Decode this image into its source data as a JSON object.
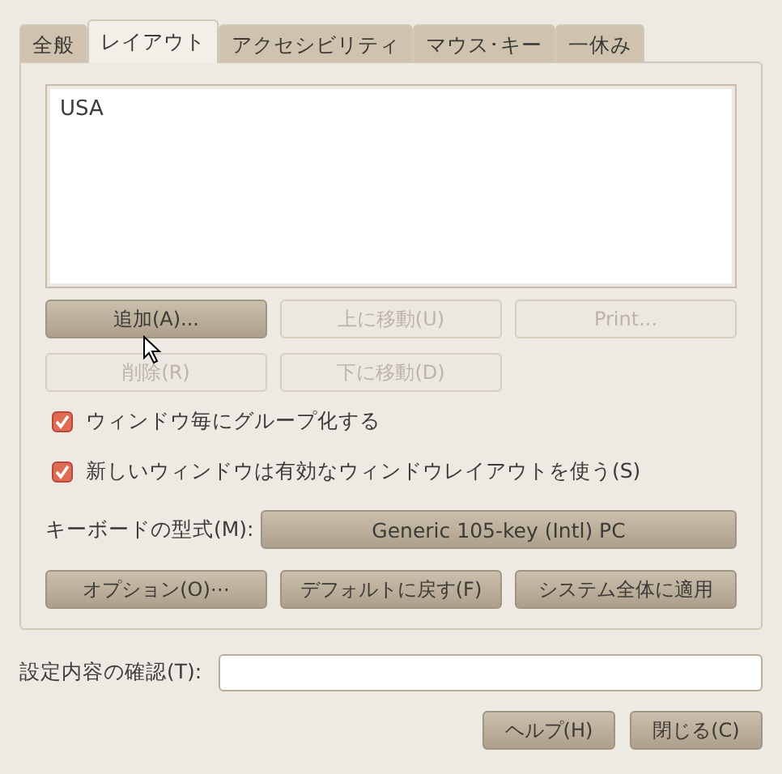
{
  "tabs": [
    {
      "label": "全般",
      "selected": false
    },
    {
      "label": "レイアウト",
      "selected": true
    },
    {
      "label": "アクセシビリティ",
      "selected": false
    },
    {
      "label": "マウス･キー",
      "selected": false
    },
    {
      "label": "一休み",
      "selected": false
    }
  ],
  "layout_list": {
    "items": [
      "USA"
    ]
  },
  "list_buttons": [
    {
      "label": "追加(A)...",
      "disabled": false
    },
    {
      "label": "上に移動(U)",
      "disabled": true
    },
    {
      "label": "Print...",
      "disabled": true
    },
    {
      "label": "削除(R)",
      "disabled": true
    },
    {
      "label": "下に移動(D)",
      "disabled": true
    }
  ],
  "checkboxes": [
    {
      "label": "ウィンドウ毎にグループ化する",
      "checked": true
    },
    {
      "label": "新しいウィンドウは有効なウィンドウレイアウトを使う(S)",
      "checked": true
    }
  ],
  "keyboard_model": {
    "label": "キーボードの型式(M):",
    "value": "Generic 105-key (Intl) PC"
  },
  "panel_buttons": [
    {
      "label": "オプション(O)⋯",
      "disabled": false
    },
    {
      "label": "デフォルトに戻す(F)",
      "disabled": false
    },
    {
      "label": "システム全体に適用",
      "disabled": false
    }
  ],
  "test_field": {
    "label": "設定内容の確認(T):"
  },
  "dialog_buttons": [
    {
      "label": "ヘルプ(H)",
      "disabled": false
    },
    {
      "label": "閉じる(C)",
      "disabled": false
    }
  ]
}
